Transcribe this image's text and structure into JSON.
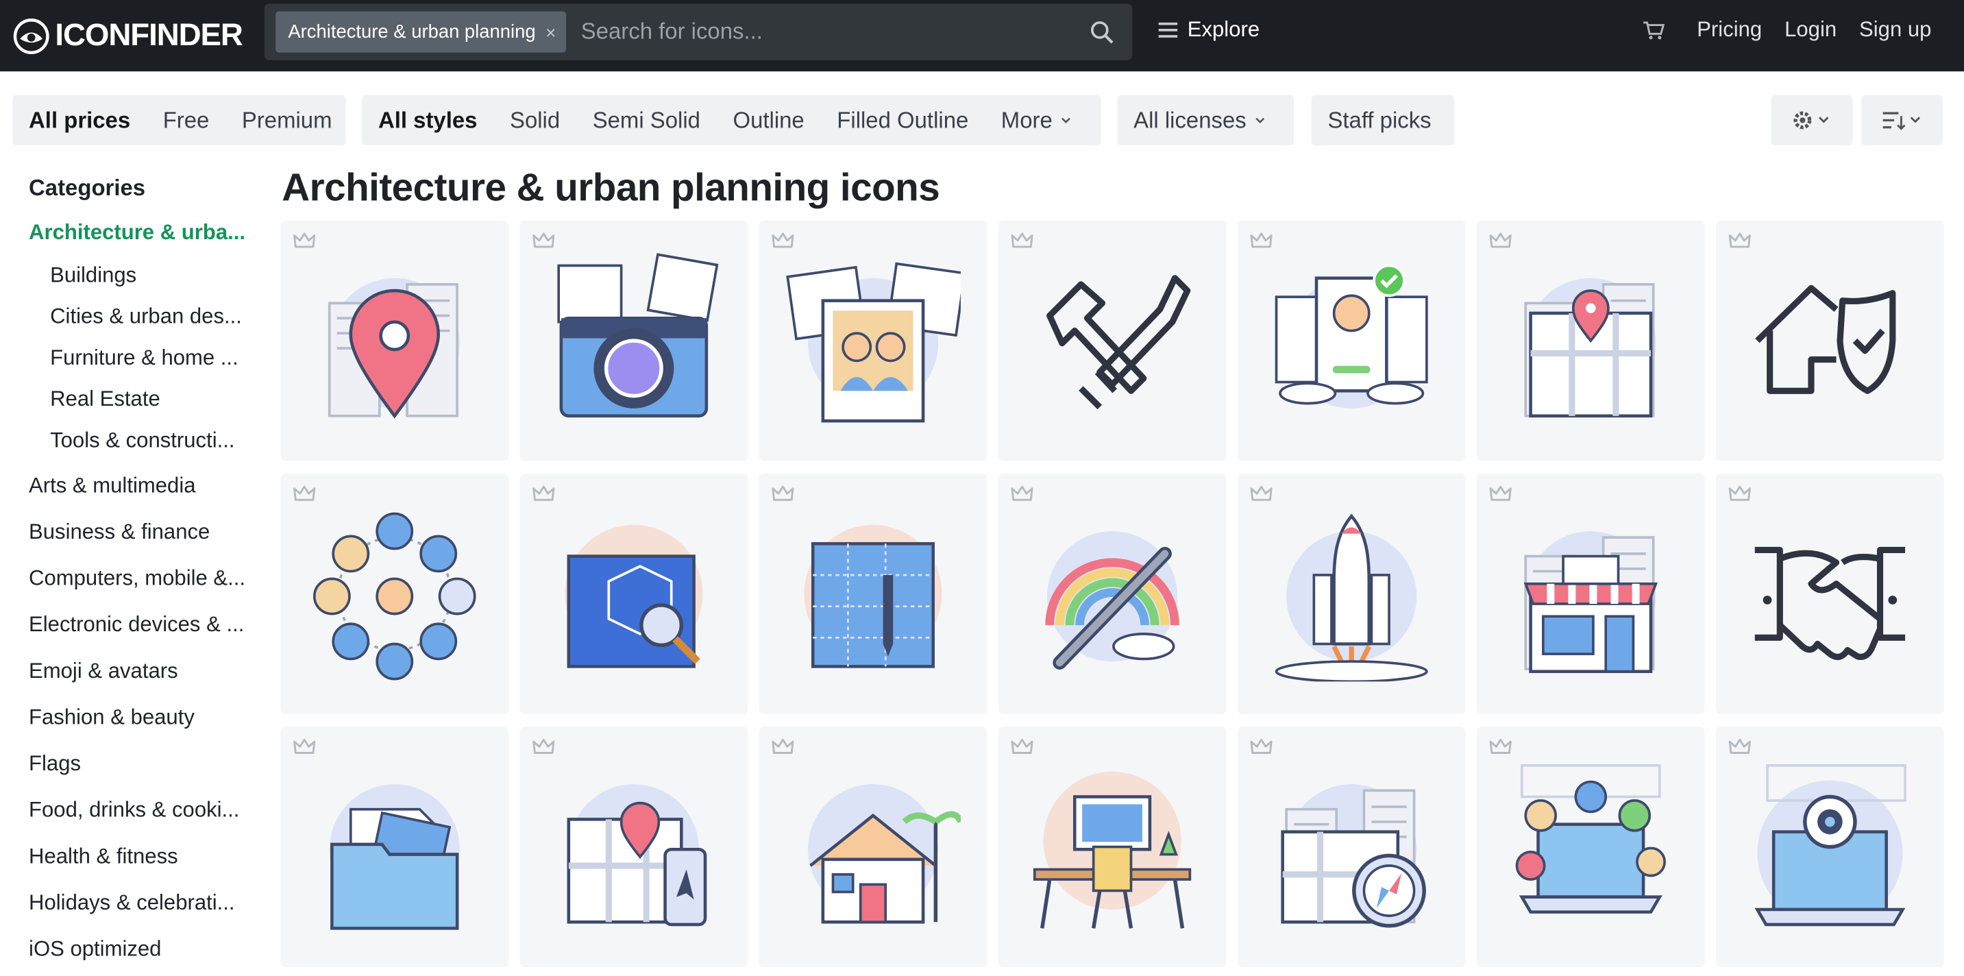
{
  "header": {
    "logo_text": "ICONFINDER",
    "search_chip": "Architecture & urban planning",
    "search_chip_close": "×",
    "search_placeholder": "Search for icons...",
    "explore": "Explore",
    "pricing": "Pricing",
    "login": "Login",
    "signup": "Sign up"
  },
  "filters": {
    "prices": [
      "All prices",
      "Free",
      "Premium"
    ],
    "styles": [
      "All styles",
      "Solid",
      "Semi Solid",
      "Outline",
      "Filled Outline",
      "More"
    ],
    "licenses": "All licenses",
    "staff_picks": "Staff picks"
  },
  "sidebar": {
    "heading": "Categories",
    "active": "Architecture & urba...",
    "subitems": [
      "Buildings",
      "Cities & urban des...",
      "Furniture & home ...",
      "Real Estate",
      "Tools & constructi..."
    ],
    "items": [
      "Arts & multimedia",
      "Business & finance",
      "Computers, mobile &...",
      "Electronic devices & ...",
      "Emoji & avatars",
      "Fashion & beauty",
      "Flags",
      "Food, drinks & cooki...",
      "Health & fitness",
      "Holidays & celebrati...",
      "iOS optimized"
    ]
  },
  "page": {
    "title": "Architecture & urban planning icons"
  },
  "colors": {
    "topbar": "#1b1f23",
    "accent_green": "#14935c",
    "tile_bg": "#f5f6f7",
    "filter_bg": "#eff1f3"
  },
  "icons": [
    {
      "name": "location-pin-city-icon"
    },
    {
      "name": "camera-photos-icon"
    },
    {
      "name": "polaroid-photo-icon"
    },
    {
      "name": "hammer-screwdriver-icon"
    },
    {
      "name": "profile-cards-check-icon"
    },
    {
      "name": "map-pin-city-icon"
    },
    {
      "name": "house-shield-check-icon"
    },
    {
      "name": "people-network-icon"
    },
    {
      "name": "blueprint-cube-magnifier-icon"
    },
    {
      "name": "blueprint-pen-icon"
    },
    {
      "name": "rainbow-magic-wand-icon"
    },
    {
      "name": "rocket-launch-icon"
    },
    {
      "name": "storefront-icon"
    },
    {
      "name": "handshake-icon"
    },
    {
      "name": "folder-images-icon"
    },
    {
      "name": "map-phone-navigation-icon"
    },
    {
      "name": "house-palm-trees-icon"
    },
    {
      "name": "workspace-desk-icon"
    },
    {
      "name": "map-compass-icon"
    },
    {
      "name": "laptop-people-icon"
    },
    {
      "name": "laptop-webcam-icon"
    }
  ]
}
